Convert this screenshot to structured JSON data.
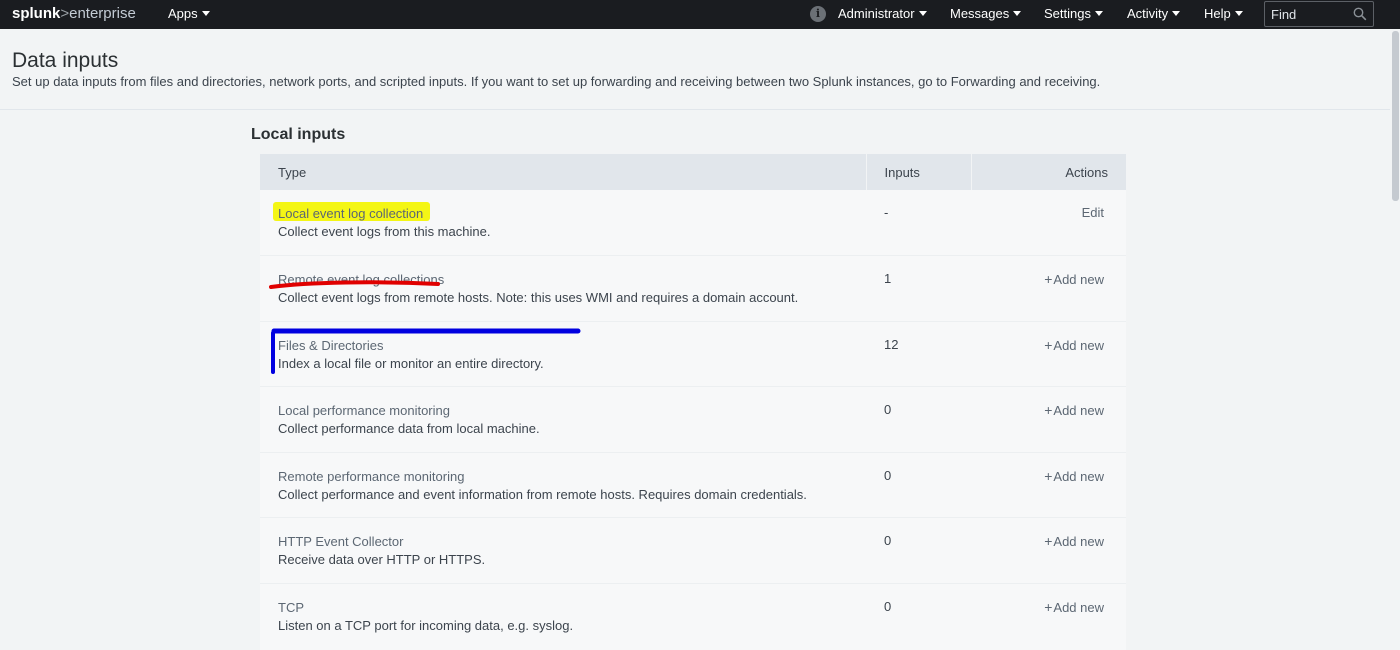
{
  "nav": {
    "logo_brand": "splunk",
    "logo_sep": ">",
    "logo_product": "enterprise",
    "apps": "Apps",
    "user": "Administrator",
    "messages": "Messages",
    "settings": "Settings",
    "activity": "Activity",
    "help": "Help",
    "find_placeholder": "Find",
    "icons": [
      "info-icon",
      "search-icon",
      "caret-down-icon"
    ]
  },
  "header": {
    "title": "Data inputs",
    "description_prefix": "Set up data inputs from files and directories, network ports, and scripted inputs. If you want to set up forwarding and receiving between two Splunk instances, go to ",
    "description_link": "Forwarding and receiving",
    "description_suffix": "."
  },
  "section": {
    "title": "Local inputs",
    "columns": {
      "type": "Type",
      "inputs": "Inputs",
      "actions": "Actions"
    },
    "rows": [
      {
        "title": "Local event log collection",
        "desc": "Collect event logs from this machine.",
        "inputs": "-",
        "action": "Edit",
        "action_icon": ""
      },
      {
        "title": "Remote event log collections",
        "desc": "Collect event logs from remote hosts. Note: this uses WMI and requires a domain account.",
        "inputs": "1",
        "action": "Add new",
        "action_icon": "+"
      },
      {
        "title": "Files & Directories",
        "desc": "Index a local file or monitor an entire directory.",
        "inputs": "12",
        "action": "Add new",
        "action_icon": "+"
      },
      {
        "title": "Local performance monitoring",
        "desc": "Collect performance data from local machine.",
        "inputs": "0",
        "action": "Add new",
        "action_icon": "+"
      },
      {
        "title": "Remote performance monitoring",
        "desc": "Collect performance and event information from remote hosts. Requires domain credentials.",
        "inputs": "0",
        "action": "Add new",
        "action_icon": "+"
      },
      {
        "title": "HTTP Event Collector",
        "desc": "Receive data over HTTP or HTTPS.",
        "inputs": "0",
        "action": "Add new",
        "action_icon": "+"
      },
      {
        "title": "TCP",
        "desc": "Listen on a TCP port for incoming data, e.g. syslog.",
        "inputs": "0",
        "action": "Add new",
        "action_icon": "+"
      }
    ]
  },
  "annotation_colors": {
    "highlight": "#f4f615",
    "underline": "#e00000",
    "bracket": "#0000e0"
  }
}
